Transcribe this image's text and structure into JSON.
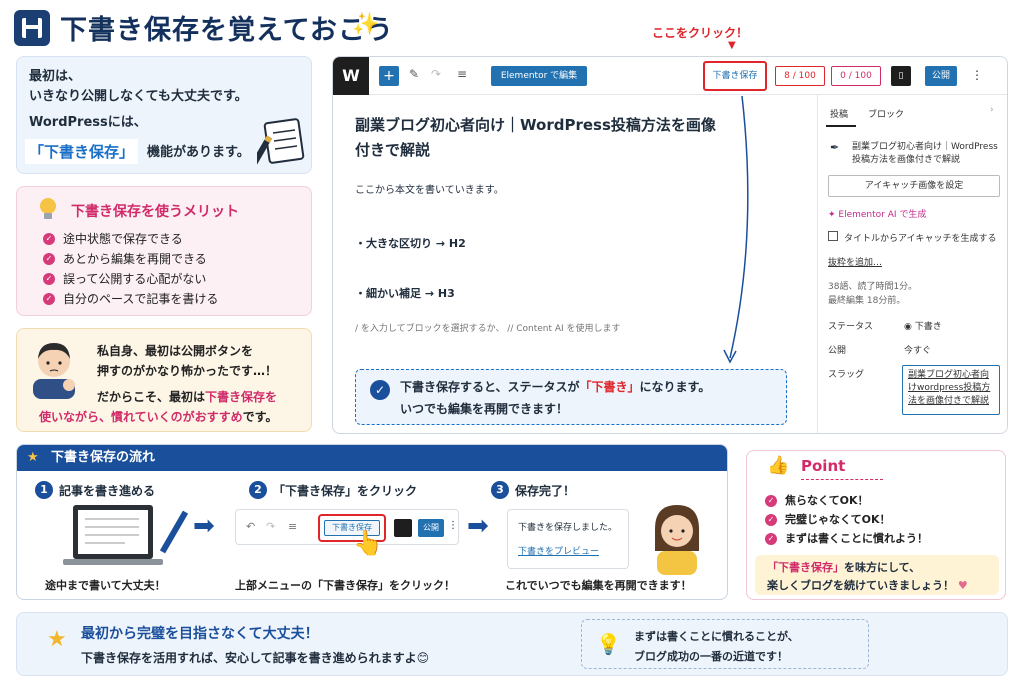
{
  "header": {
    "title": "下書き保存を覚えておこう",
    "sparkle": "✨"
  },
  "intro": {
    "line1": "最初は、",
    "line2": "いきなり公開しなくても大丈夫です。",
    "line3": "WordPressには、",
    "highlight": "「下書き保存」",
    "line4": "機能があります。"
  },
  "merit": {
    "title": "下書き保存を使うメリット",
    "items": [
      "途中状態で保存できる",
      "あとから編集を再開できる",
      "誤って公開する心配がない",
      "自分のペースで記事を書ける"
    ]
  },
  "quote": {
    "line1": "私自身、最初は公開ボタンを",
    "line2": "押すのがかなり怖かったです…！",
    "line3a": "だからこそ、最初は",
    "line3b": "下書き保存を",
    "line4a": "使いながら、",
    "line4b": "慣れていくのがおすすめ",
    "line4c": "です。"
  },
  "annotation": {
    "click_here": "ここをクリック！"
  },
  "editor": {
    "toolbar": {
      "elementor": "Elementor で編集",
      "draft": "下書き保存",
      "seo": "8 / 100",
      "readability": "0 / 100",
      "publish": "公開",
      "more": "⋮"
    },
    "post_title": "副業ブログ初心者向け｜WordPress投稿方法を画像付きで解説",
    "body_intro": "ここから本文を書いていきます。",
    "h2": "・大きな区切り → H2",
    "h3": "・細かい補足 → H3",
    "placeholder": "/ を入力してブロックを選択するか、 // Content AI を使用します",
    "callout_l1a": "下書き保存すると、ステータスが",
    "callout_l1b": "「下書き」",
    "callout_l1c": "になります。",
    "callout_l2": "いつでも編集を再開できます！",
    "sidebar": {
      "tab_post": "投稿",
      "tab_block": "ブロック",
      "chevron": "›",
      "post_title": "副業ブログ初心者向け｜WordPress投稿方法を画像付きで解説",
      "featured_btn": "アイキャッチ画像を設定",
      "ai": "Elementor AI で生成",
      "gen_checkbox": "タイトルからアイキャッチを生成する",
      "excerpt": "抜粋を追加…",
      "meta1": "38語、読了時間1分。",
      "meta2": "最終編集 18分前。",
      "status_label": "ステータス",
      "status_value": "下書き",
      "publish_label": "公開",
      "publish_value": "今すぐ",
      "slug_label": "スラッグ",
      "slug_value": "副業ブログ初心者向けwordpress投稿方法を画像付きで解説"
    }
  },
  "flow": {
    "title": "下書き保存の流れ",
    "steps": [
      {
        "num": "1",
        "title": "記事を書き進める",
        "caption": "途中まで書いて大丈夫！"
      },
      {
        "num": "2",
        "title": "「下書き保存」をクリック",
        "caption": "上部メニューの「下書き保存」をクリック！",
        "btn": "下書き保存",
        "publish": "公開"
      },
      {
        "num": "3",
        "title": "保存完了！",
        "caption": "これでいつでも編集を再開できます！",
        "msg": "下書きを保存しました。",
        "link": "下書きをプレビュー"
      }
    ]
  },
  "point": {
    "title": "Point",
    "items": [
      "焦らなくてOK！",
      "完璧じゃなくてOK！",
      "まずは書くことに慣れよう！"
    ],
    "note1a": "「下書き保存」",
    "note1b": "を味方にして、",
    "note2": "楽しくブログを続けていきましょう！"
  },
  "bottom": {
    "title": "最初から完璧を目指さなくて大丈夫！",
    "sub": "下書き保存を活用すれば、安心して記事を書き進められますよ😊",
    "tip1": "まずは書くことに慣れることが、",
    "tip2": "ブログ成功の一番の近道です！"
  },
  "colors": {
    "navy": "#14305c",
    "blue": "#1a4f9c",
    "pink": "#d12b6a",
    "red": "#e0252b"
  }
}
